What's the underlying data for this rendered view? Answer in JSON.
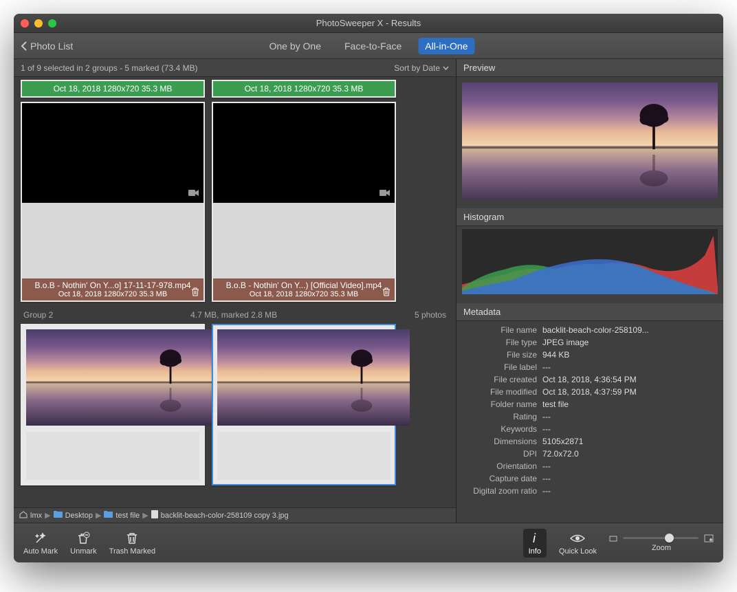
{
  "title": "PhotoSweeper X - Results",
  "back_label": "Photo List",
  "tabs": {
    "one": "One by One",
    "face": "Face-to-Face",
    "all": "All-in-One"
  },
  "status": "1 of 9 selected in 2 groups - 5 marked (73.4 MB)",
  "sort_label": "Sort by Date",
  "green1": "Oct 18, 2018  1280x720  35.3 MB",
  "green2": "Oct 18, 2018  1280x720  35.3 MB",
  "brown1_fn": "B.o.B - Nothin' On Y...o] 17-11-17-978.mp4",
  "brown1_meta": "Oct 18, 2018  1280x720  35.3 MB",
  "brown2_fn": "B.o.B - Nothin' On Y...) [Official Video].mp4",
  "brown2_meta": "Oct 18, 2018  1280x720  35.3 MB",
  "group2": {
    "name": "Group 2",
    "size": "4.7 MB, marked 2.8 MB",
    "count": "5 photos"
  },
  "breadcrumb": {
    "p1": "lmx",
    "p2": "Desktop",
    "p3": "test file",
    "p4": "backlit-beach-color-258109 copy 3.jpg"
  },
  "btns": {
    "automark": "Auto Mark",
    "unmark": "Unmark",
    "trash": "Trash Marked",
    "info": "Info",
    "quicklook": "Quick Look",
    "zoom": "Zoom"
  },
  "panels": {
    "preview": "Preview",
    "histogram": "Histogram",
    "metadata": "Metadata"
  },
  "meta": {
    "filename_k": "File name",
    "filename_v": "backlit-beach-color-258109...",
    "filetype_k": "File type",
    "filetype_v": "JPEG image",
    "filesize_k": "File size",
    "filesize_v": "944 KB",
    "filelabel_k": "File label",
    "filelabel_v": "---",
    "filecreated_k": "File created",
    "filecreated_v": "Oct 18, 2018, 4:36:54 PM",
    "filemodified_k": "File modified",
    "filemodified_v": "Oct 18, 2018, 4:37:59 PM",
    "foldername_k": "Folder name",
    "foldername_v": "test file",
    "rating_k": "Rating",
    "rating_v": "---",
    "keywords_k": "Keywords",
    "keywords_v": "---",
    "dimensions_k": "Dimensions",
    "dimensions_v": "5105x2871",
    "dpi_k": "DPI",
    "dpi_v": "72.0x72.0",
    "orientation_k": "Orientation",
    "orientation_v": "---",
    "capturedate_k": "Capture date",
    "capturedate_v": "---",
    "digitalzoom_k": "Digital zoom ratio",
    "digitalzoom_v": "---"
  }
}
